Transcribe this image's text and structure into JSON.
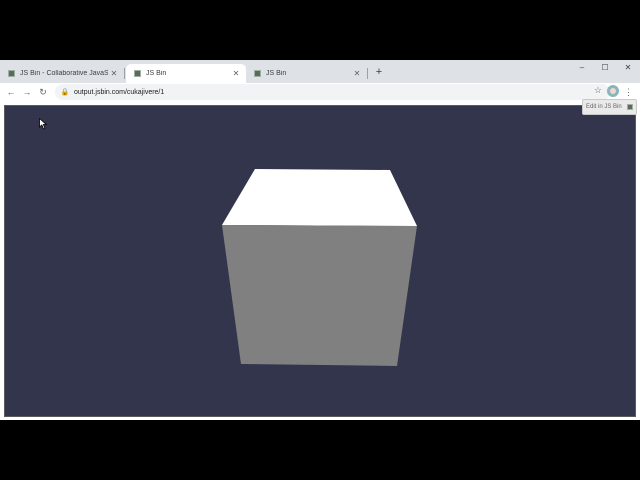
{
  "tabs": [
    {
      "title": "JS Bin - Collaborative JavaScript Debugging",
      "icon": "jsbin-favicon"
    },
    {
      "title": "JS Bin",
      "icon": "jsbin-favicon"
    },
    {
      "title": "JS Bin",
      "icon": "jsbin-favicon"
    }
  ],
  "active_tab": 1,
  "address_bar": {
    "url": "output.jsbin.com/cukajivere/1"
  },
  "edit_button": {
    "label": "Edit in JS Bin"
  },
  "window_controls": {
    "minimize": "–",
    "maximize": "☐",
    "close": "✕"
  },
  "icons": {
    "back": "back-arrow-icon",
    "forward": "forward-arrow-icon",
    "reload": "reload-icon",
    "lock": "lock-icon",
    "star": "bookmark-star-icon",
    "menu": "kebab-menu-icon"
  },
  "colors": {
    "scene_background": "#33354c",
    "cube_top": "#ffffff",
    "cube_front": "#808080"
  }
}
